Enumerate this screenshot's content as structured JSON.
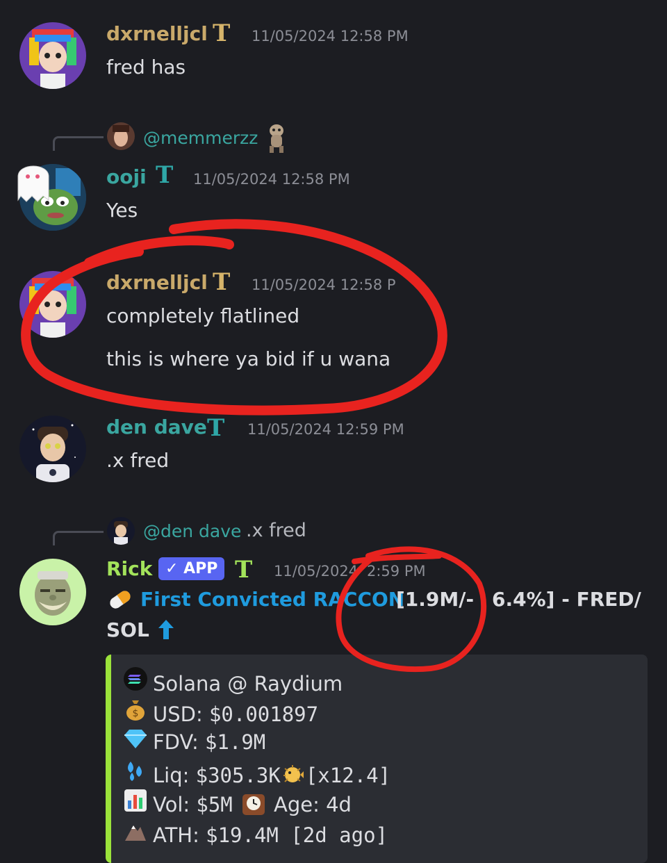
{
  "colors": {
    "background": "#1c1d22",
    "name_gold": "#c9a96a",
    "name_teal": "#3aa6a0",
    "name_green": "#a3e35b",
    "link_blue": "#1f9bde",
    "embed_bar": "#9be33b",
    "annotation_red": "#e8231f"
  },
  "messages": [
    {
      "author": "dxrnelljcl",
      "badge": "T",
      "timestamp": "11/05/2024 12:58 PM",
      "lines": [
        "fred has"
      ]
    },
    {
      "reply_to": "@memmerzz",
      "author": "ooji",
      "badge": "T",
      "timestamp": "11/05/2024 12:58 PM",
      "lines": [
        "Yes"
      ]
    },
    {
      "author": "dxrnelljcl",
      "badge": "T",
      "timestamp": "11/05/2024 12:58 P",
      "lines": [
        "completely flatlined",
        "this is where ya bid if u wana"
      ]
    },
    {
      "author": "den dave",
      "badge": "T",
      "timestamp": "11/05/2024 12:59 PM",
      "lines": [
        ".x fred"
      ]
    },
    {
      "reply_to": "@den dave",
      "reply_text": ".x fred",
      "author": "Rick",
      "app_badge": "✓ APP",
      "badge": "T",
      "timestamp_left": "11/05/2024",
      "timestamp_right": "2:59 PM",
      "headline": {
        "link": "First Convicted RACCON",
        "rest_line1": " [1.9M/-",
        "rest_line1b": "6.4%] - FRED/",
        "line2": "SOL"
      },
      "embed": [
        {
          "icon": "solana-icon",
          "label": "Solana @ Raydium"
        },
        {
          "icon": "money-bag-icon",
          "label": "USD: ",
          "value": "$0.001897"
        },
        {
          "icon": "gem-icon",
          "label": "FDV: ",
          "value": "$1.9M"
        },
        {
          "icon": "droplets-icon",
          "label": "Liq: ",
          "value": "$305.3K",
          "extra": "[x12.4]"
        },
        {
          "icon": "bar-chart-icon",
          "label": "Vol: ",
          "value": "$5M",
          "label2": " Age: 4d"
        },
        {
          "icon": "mountain-icon",
          "label": "ATH: ",
          "value": "$19.4M [2d ago]"
        }
      ]
    }
  ]
}
